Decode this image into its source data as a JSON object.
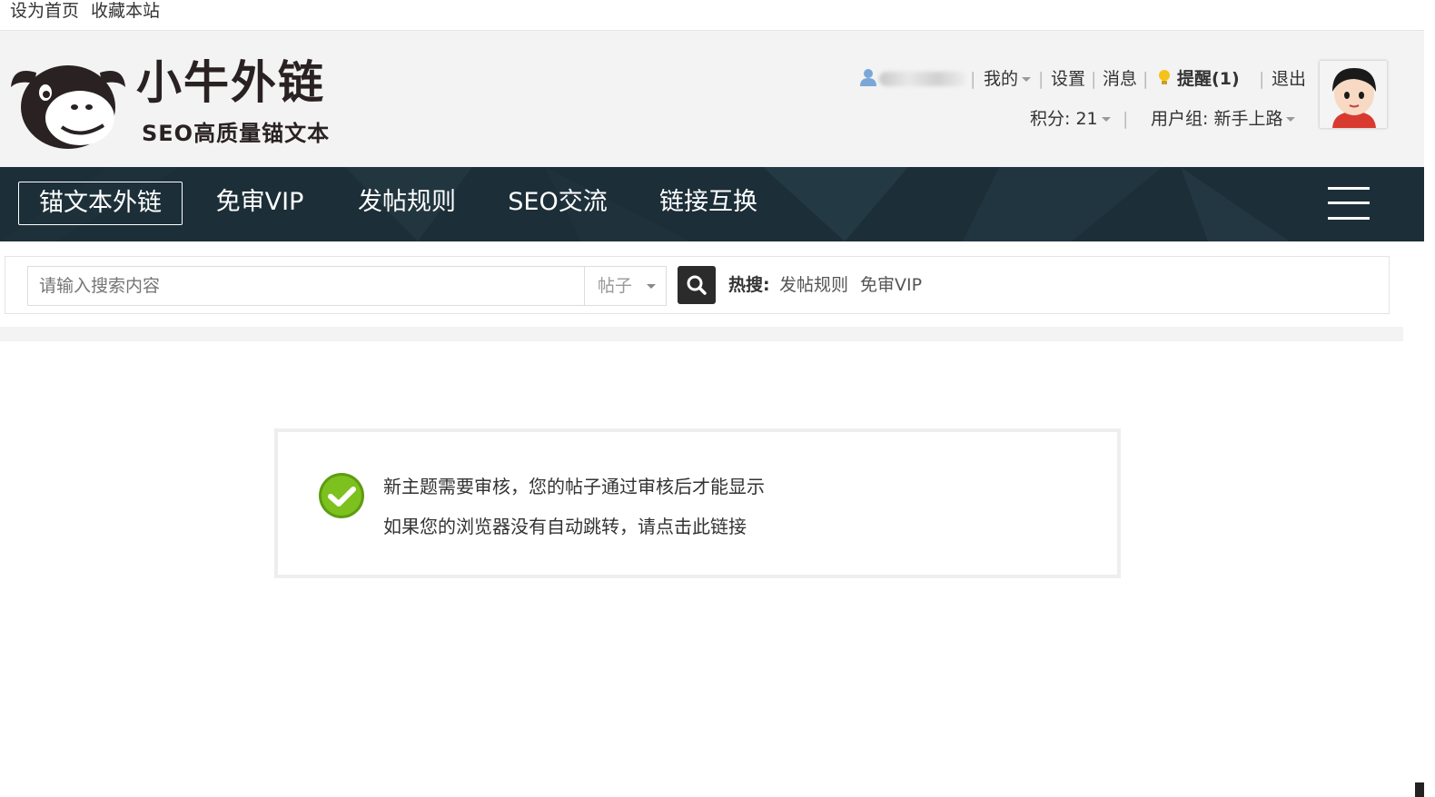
{
  "topbar": {
    "set_home": "设为首页",
    "bookmark": "收藏本站"
  },
  "header": {
    "brand_name": "小牛外链",
    "brand_sub": "SEO高质量锚文本",
    "user": {
      "my": "我的",
      "settings": "设置",
      "messages": "消息",
      "reminder": "提醒(1)",
      "logout": "退出",
      "points": "积分: 21",
      "user_group": "用户组: 新手上路"
    }
  },
  "nav": {
    "items": [
      {
        "label": "锚文本外链"
      },
      {
        "label": "免审VIP"
      },
      {
        "label": "发帖规则"
      },
      {
        "label": "SEO交流"
      },
      {
        "label": "链接互换"
      }
    ]
  },
  "search": {
    "placeholder": "请输入搜索内容",
    "type_selected": "帖子",
    "hot_label": "热搜:",
    "hot_links": [
      "发帖规则",
      "免审VIP"
    ]
  },
  "message": {
    "line1": "新主题需要审核，您的帖子通过审核后才能显示",
    "line2": "如果您的浏览器没有自动跳转，请点击此链接"
  },
  "colors": {
    "nav_bg": "#1c2e38",
    "header_bg": "#f3f3f3",
    "success_green": "#7cc11d",
    "reminder_bulb": "#f5c21b"
  }
}
